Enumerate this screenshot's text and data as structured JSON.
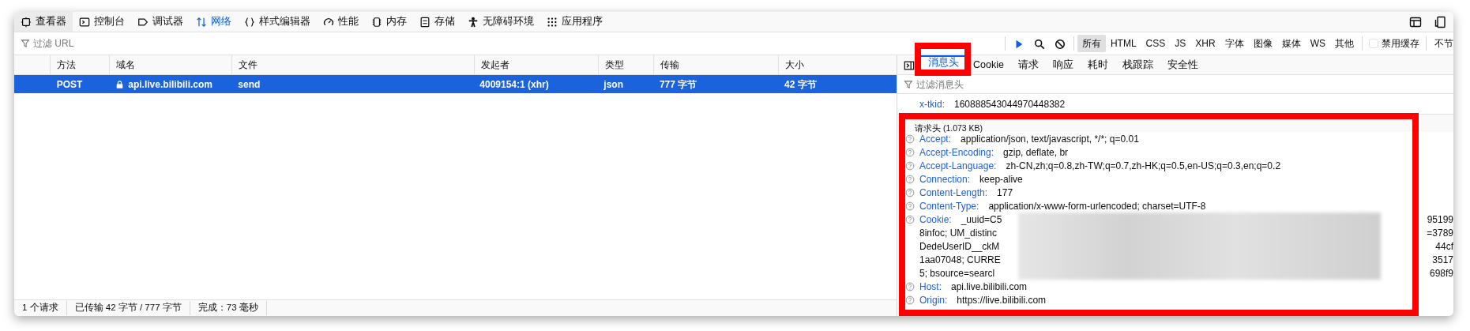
{
  "toolbar_tabs": [
    {
      "label": "查看器",
      "selected": false
    },
    {
      "label": "控制台",
      "selected": false
    },
    {
      "label": "调试器",
      "selected": false
    },
    {
      "label": "网络",
      "selected": true
    },
    {
      "label": "样式编辑器",
      "selected": false
    },
    {
      "label": "性能",
      "selected": false
    },
    {
      "label": "内存",
      "selected": false
    },
    {
      "label": "存储",
      "selected": false
    },
    {
      "label": "无障碍环境",
      "selected": false
    },
    {
      "label": "应用程序",
      "selected": false
    }
  ],
  "filter": {
    "placeholder": "过滤 URL"
  },
  "type_filters": [
    {
      "label": "所有",
      "selected": true
    },
    {
      "label": "HTML",
      "selected": false
    },
    {
      "label": "CSS",
      "selected": false
    },
    {
      "label": "JS",
      "selected": false
    },
    {
      "label": "XHR",
      "selected": false
    },
    {
      "label": "字体",
      "selected": false
    },
    {
      "label": "图像",
      "selected": false
    },
    {
      "label": "媒体",
      "selected": false
    },
    {
      "label": "WS",
      "selected": false
    },
    {
      "label": "其他",
      "selected": false
    }
  ],
  "disable_cache": {
    "label": "禁用缓存",
    "checked": false
  },
  "throttle": "不节",
  "table": {
    "columns": [
      "方法",
      "域名",
      "文件",
      "发起者",
      "类型",
      "传输",
      "大小"
    ],
    "rows": [
      {
        "selected": true,
        "secure": true,
        "cells": [
          "POST",
          "api.live.bilibili.com",
          "send",
          "4009154:1 (xhr)",
          "json",
          "777 字节",
          "42 字节"
        ]
      }
    ]
  },
  "details": {
    "tabs": [
      {
        "label": "消息头",
        "selected": true,
        "highlighted": true
      },
      {
        "label": "Cookie",
        "selected": false,
        "highlighted": false
      },
      {
        "label": "请求",
        "selected": false,
        "highlighted": false
      },
      {
        "label": "响应",
        "selected": false,
        "highlighted": false
      },
      {
        "label": "耗时",
        "selected": false,
        "highlighted": false
      },
      {
        "label": "栈跟踪",
        "selected": false,
        "highlighted": false
      },
      {
        "label": "安全性",
        "selected": false,
        "highlighted": false
      }
    ],
    "filter": {
      "placeholder": "过滤消息头"
    },
    "response_headers": [
      {
        "name": "x-tkid:",
        "value": "160888543044970448382"
      }
    ],
    "request_section": {
      "title": "请求头 (1.073 KB)",
      "highlighted": true,
      "headers": [
        {
          "kind": "plain",
          "name": "Accept:",
          "value": "application/json, text/javascript, */*; q=0.01"
        },
        {
          "kind": "plain",
          "name": "Accept-Encoding:",
          "value": "gzip, deflate, br"
        },
        {
          "kind": "plain",
          "name": "Accept-Language:",
          "value": "zh-CN,zh;q=0.8,zh-TW;q=0.7,zh-HK;q=0.5,en-US;q=0.3,en;q=0.2"
        },
        {
          "kind": "plain",
          "name": "Connection:",
          "value": "keep-alive"
        },
        {
          "kind": "plain",
          "name": "Content-Length:",
          "value": "177"
        },
        {
          "kind": "plain",
          "name": "Content-Type:",
          "value": "application/x-www-form-urlencoded; charset=UTF-8"
        },
        {
          "kind": "redacted",
          "name": "Cookie:",
          "lines": [
            {
              "start": "_uuid=C5",
              "end": "95199"
            },
            {
              "start": "8infoc; UM_distinc",
              "end": "=3789"
            },
            {
              "start": "DedeUserID__ckM",
              "end": "44cf"
            },
            {
              "start": "1aa07048; CURRE",
              "end": "3517"
            },
            {
              "start": "5; bsource=searcl",
              "end": "698f9"
            }
          ]
        },
        {
          "kind": "plain",
          "name": "Host:",
          "value": "api.live.bilibili.com"
        },
        {
          "kind": "plain",
          "name": "Origin:",
          "value": "https://live.bilibili.com"
        }
      ]
    }
  },
  "status_bar": [
    "1 个请求",
    "已传输 42 字节 / 777 字节",
    "完成：73 毫秒"
  ]
}
